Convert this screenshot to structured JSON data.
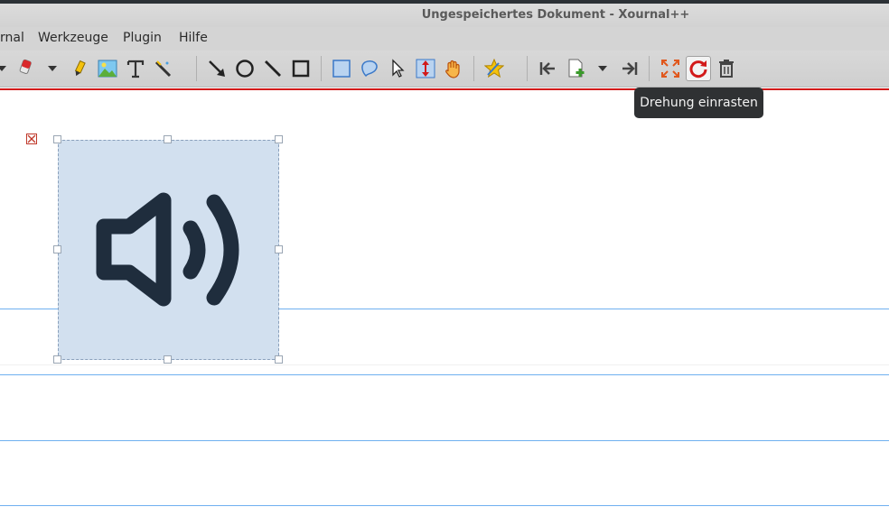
{
  "window": {
    "title": "Ungespeichertes Dokument - Xournal++"
  },
  "menu": {
    "items": [
      "rnal",
      "Werkzeuge",
      "Plugin",
      "Hilfe"
    ]
  },
  "tooltip": {
    "text": "Drehung einrasten"
  },
  "toolbar": {
    "icons": [
      "eraser-icon",
      "highlighter-icon",
      "image-icon",
      "text-icon",
      "ruler-pen-icon",
      "arrow-icon",
      "ellipse-icon",
      "line-icon",
      "rectangle-icon",
      "select-rect-icon",
      "select-lasso-icon",
      "select-object-icon",
      "vertical-space-icon",
      "hand-icon",
      "star-icon",
      "first-page-icon",
      "new-page-icon",
      "last-page-icon",
      "fullscreen-icon",
      "rotation-snap-icon",
      "delete-icon"
    ]
  },
  "colors": {
    "accent_red": "#d21a1a",
    "rule_blue": "#6fb0f0",
    "selection_fill": "#d2e0ef",
    "tooltip_bg": "#2f3133"
  }
}
